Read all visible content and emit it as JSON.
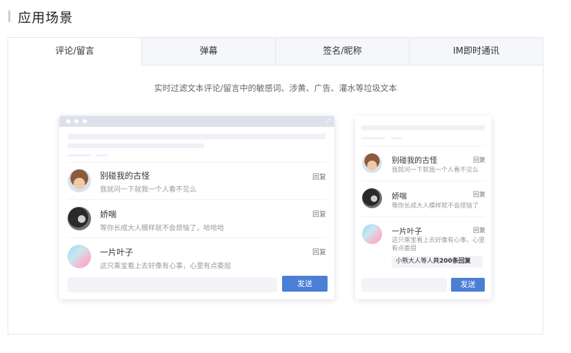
{
  "section_title": "应用场景",
  "tabs": [
    {
      "label": "评论/留言",
      "active": true
    },
    {
      "label": "弹幕",
      "active": false
    },
    {
      "label": "签名/昵称",
      "active": false
    },
    {
      "label": "IM即时通讯",
      "active": false
    }
  ],
  "subtitle": "实时过滤文本评论/留言中的敏感词、涉黄、广告、灌水等垃圾文本",
  "desktop": {
    "comments": [
      {
        "name": "别碰我的古怪",
        "text": "我就问一下就我一个人看不见么",
        "reply": "回复",
        "avatar": "girl-avatar"
      },
      {
        "name": "娇喘",
        "text": "等你长成大人模样就不会烦恼了，哈哈哈",
        "reply": "回复",
        "avatar": "bw-portrait-avatar"
      },
      {
        "name": "一片叶子",
        "text": "这只乘宝看上去好像有心事，心里有点委屈",
        "reply": "回复",
        "avatar": "gradient-avatar"
      }
    ],
    "send_label": "发送"
  },
  "mobile": {
    "comments": [
      {
        "name": "别碰我的古怪",
        "text": "我就问一下就我一个人看不见么",
        "reply": "回复"
      },
      {
        "name": "娇喘",
        "text": "等你长成大人模样就不会烦恼了",
        "reply": "回复"
      },
      {
        "name": "一片叶子",
        "text_line1": "这只乘宝看上去好像有心事，心里",
        "text_line2": "有点委屈",
        "reply": "回复"
      }
    ],
    "thread_prefix": "小熊大人等人",
    "thread_count": "共200条回复",
    "send_label": "发送"
  },
  "colors": {
    "accent": "#4a7fd6",
    "tab_bg": "#f5f7fa",
    "border": "#e3e6ec"
  }
}
